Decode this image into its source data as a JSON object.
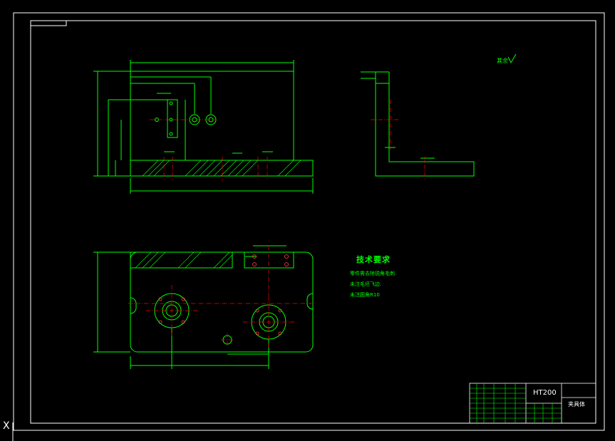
{
  "technical_requirements": {
    "title": "技术要求",
    "lines": [
      "零件需去除锐角毛刺.",
      "未注毛坯飞边.",
      "未注圆角R10"
    ]
  },
  "title_block": {
    "material": "HT200",
    "part_name": "夹具体"
  },
  "roughness_note": "其余",
  "ucs_label": "X",
  "colors": {
    "background": "#000000",
    "frame": "#ffffff",
    "geometry": "#00ff00",
    "centerline": "#ff0000",
    "hatch": "#00ff00"
  }
}
